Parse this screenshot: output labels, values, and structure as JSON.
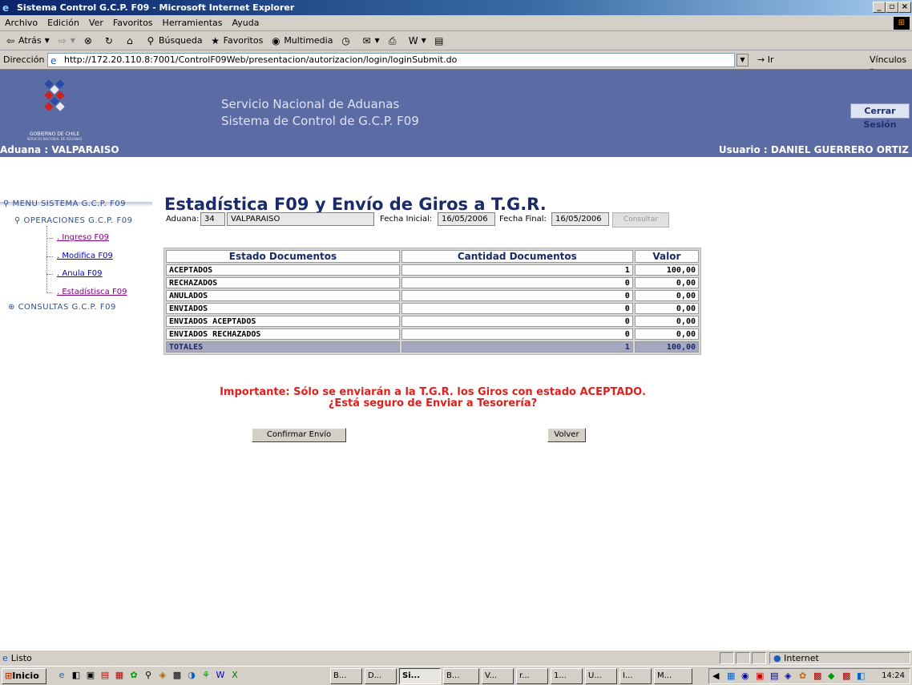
{
  "window": {
    "title": "Sistema Control G.C.P. F09 - Microsoft Internet Explorer"
  },
  "menu": [
    "Archivo",
    "Edición",
    "Ver",
    "Favoritos",
    "Herramientas",
    "Ayuda"
  ],
  "toolbar": {
    "back": "Atrás",
    "search": "Búsqueda",
    "favorites": "Favoritos",
    "media": "Multimedia"
  },
  "address": {
    "label": "Dirección",
    "url": "http://172.20.110.8:7001/ControlF09Web/presentacion/autorizacion/login/loginSubmit.do",
    "go": "Ir",
    "links": "Vínculos »"
  },
  "header": {
    "logo_text": "GOBIERNO DE CHILE",
    "logo_subtext": "SERVICIO NACIONAL DE ADUANAS",
    "service": "Servicio Nacional de Aduanas",
    "system": "Sistema de Control de G.C.P. F09",
    "logout": "Cerrar Sesión",
    "aduana": "Aduana : VALPARAISO",
    "usuario": "Usuario : DANIEL GUERRERO ORTIZ"
  },
  "sidebar": {
    "root": "MENU SISTEMA G.C.P. F09",
    "operaciones": "OPERACIONES G.C.P. F09",
    "items": [
      ". Ingreso F09",
      ". Modifica F09",
      ". Anula F09",
      ". Estadístisca F09"
    ],
    "consultas": "CONSULTAS G.C.P. F09"
  },
  "page": {
    "title": "Estadística F09 y Envío de Giros a T.G.R."
  },
  "filters": {
    "aduana_label": "Aduana:",
    "aduana_code": "34",
    "aduana_name": "VALPARAISO",
    "fecha_inicial_label": "Fecha Inicial:",
    "fecha_inicial": "16/05/2006",
    "fecha_final_label": "Fecha Final:",
    "fecha_final": "16/05/2006",
    "consultar": "Consultar"
  },
  "table": {
    "headers": [
      "Estado Documentos",
      "Cantidad Documentos",
      "Valor"
    ],
    "rows": [
      [
        "ACEPTADOS",
        "1",
        "100,00"
      ],
      [
        "RECHAZADOS",
        "0",
        "0,00"
      ],
      [
        "ANULADOS",
        "0",
        "0,00"
      ],
      [
        "ENVIADOS",
        "0",
        "0,00"
      ],
      [
        "ENVIADOS ACEPTADOS",
        "0",
        "0,00"
      ],
      [
        "ENVIADOS RECHAZADOS",
        "0",
        "0,00"
      ]
    ],
    "totals": [
      "TOTALES",
      "1",
      "100,00"
    ]
  },
  "warning": {
    "line1": "Importante: Sólo se enviarán a la T.G.R. los Giros con estado ACEPTADO.",
    "line2": "¿Está seguro de Enviar a Tesorería?"
  },
  "buttons": {
    "confirm": "Confirmar Envío",
    "back": "Volver"
  },
  "status": {
    "text": "Listo",
    "zone": "Internet"
  },
  "taskbar": {
    "start": "Inicio",
    "items": [
      "B...",
      "D...",
      "Si...",
      "B...",
      "V...",
      "r...",
      "1...",
      "U...",
      "I...",
      "M..."
    ],
    "clock": "14:24"
  },
  "colors": {
    "header_bg": "#5b6ba4",
    "title": "#1a2a6b",
    "warning": "#e0201c",
    "totals_bg": "#a6a6c0"
  }
}
